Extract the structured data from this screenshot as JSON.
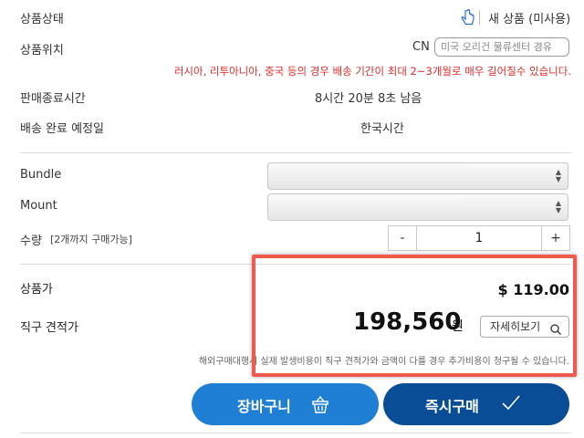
{
  "product_info": {
    "condition_label": "상품상태",
    "condition_value": "새 상품 (미사용)",
    "location_label": "상품위치",
    "location_code": "CN",
    "location_route": "미국 오리건 물류센터 경유",
    "shipping_warning": "러시아, 리투아니아, 중국 등의 경우 배송 기간이 최대 2~3개월로 매우 길어질수 있습니다.",
    "end_time_label": "판매종료시간",
    "end_time_value": "8시간 20분 8초 남음",
    "delivery_label": "배송 완료 예정일",
    "delivery_value": "한국시간"
  },
  "options": {
    "bundle_label": "Bundle",
    "bundle_value": "",
    "mount_label": "Mount",
    "mount_value": "",
    "quantity_label": "수량",
    "quantity_limit": "[2개까지 구매가능]",
    "minus_label": "-",
    "quantity_value": "1",
    "plus_label": "+"
  },
  "pricing": {
    "item_price_label": "상품가",
    "item_price_value": "$ 119.00",
    "estimate_label": "직구 견적가",
    "estimate_amount": "198,560",
    "estimate_unit": "원",
    "detail_button": "자세히보기",
    "notice": "해외구매대행시 실제 발생비용이 직구 견적가와 금액이 다를 경우 추가비용이 청구될 수 있습니다."
  },
  "actions": {
    "cart_label": "장바구니",
    "buy_label": "즉시구매"
  },
  "colors": {
    "cart_button": "#1e7fd4",
    "buy_button": "#0a4d97",
    "warning_text": "#e12a2a",
    "highlight_border": "#f05a4e"
  }
}
